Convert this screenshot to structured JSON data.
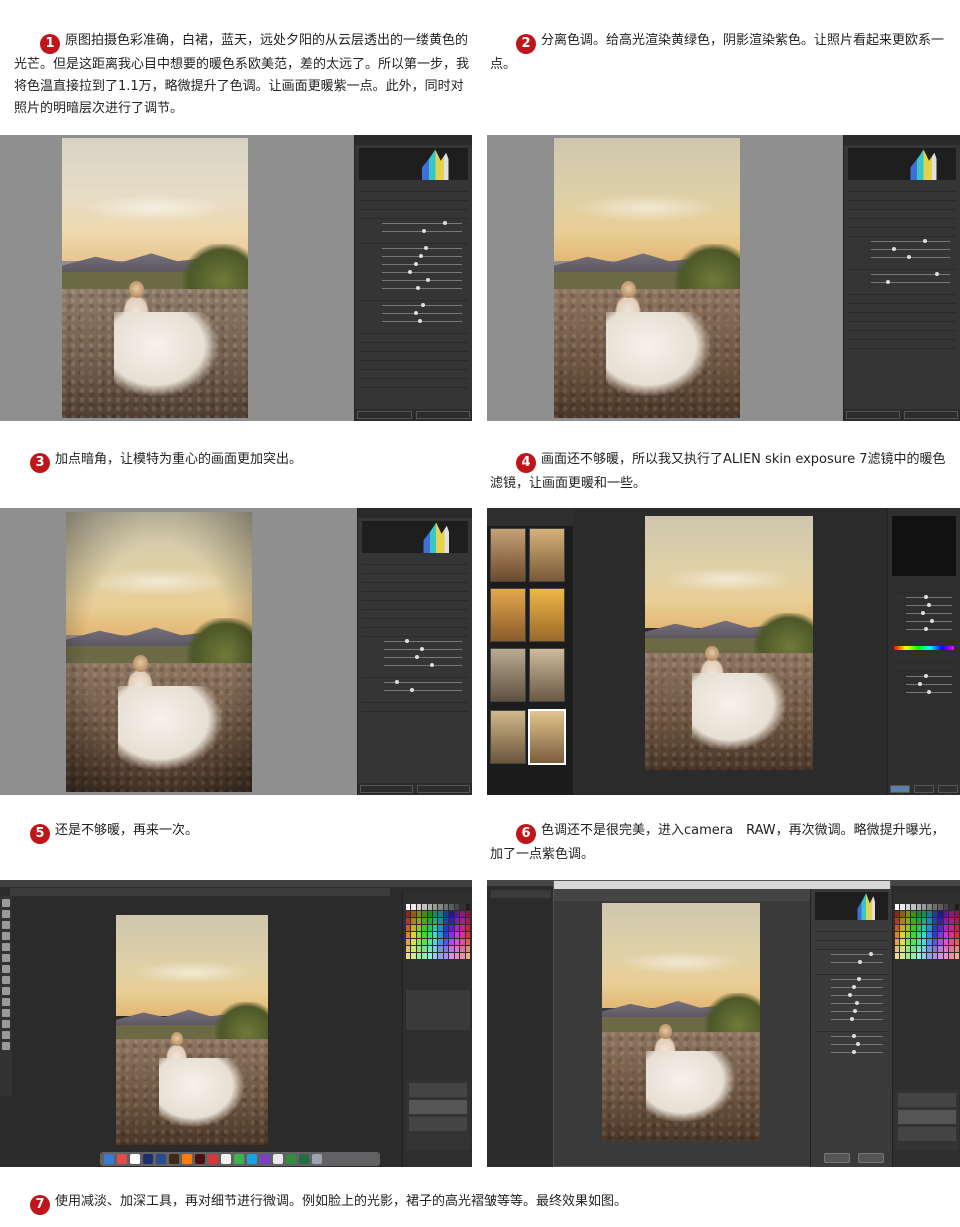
{
  "steps": [
    {
      "num": "1",
      "text": "原图拍摄色彩准确，白裙，蓝天，远处夕阳的从云层透出的一缕黄色的光芒。但是这距离我心目中想要的暖色系欧美范，差的太远了。所以第一步，我将色温直接拉到了1.1万，略微提升了色调。让画面更暖紫一点。此外，同时对照片的明暗层次进行了调节。"
    },
    {
      "num": "2",
      "text": "分离色调。给高光渲染黄绿色，阴影渲染紫色。让照片看起来更欧系一点。"
    },
    {
      "num": "3",
      "text": "加点暗角，让模特为重心的画面更加突出。"
    },
    {
      "num": "4",
      "text": "画面还不够暖，所以我又执行了ALIEN skin exposure 7滤镜中的暖色滤镜，让画面更暖和一些。"
    },
    {
      "num": "5",
      "text": "还是不够暖，再来一次。"
    },
    {
      "num": "6",
      "text": "色调还不是很完美，进入camera　RAW，再次微调。略微提升曝光，加了一点紫色调。"
    },
    {
      "num": "7",
      "text": "使用减淡、加深工具，再对细节进行微调。例如脸上的光影，裙子的高光褶皱等等。最终效果如图。"
    }
  ],
  "colors": {
    "badge": "#c0161b",
    "panel": "#353535",
    "gray_backdrop": "#8f8f8f",
    "dark_backdrop": "#2b2b2b"
  },
  "icons": [
    "histogram-icon",
    "thumbnail-icon",
    "tool-icon",
    "swatch-icon",
    "dock-app-icon"
  ]
}
